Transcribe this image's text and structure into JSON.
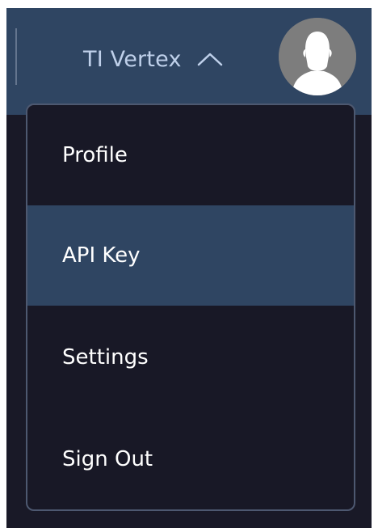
{
  "header": {
    "account_name": "TI Vertex",
    "toggle_icon": "chevron-up-icon",
    "avatar_icon": "user-avatar-icon"
  },
  "menu": {
    "items": [
      {
        "label": "Profile",
        "active": false
      },
      {
        "label": "API Key",
        "active": true
      },
      {
        "label": "Settings",
        "active": false
      },
      {
        "label": "Sign Out",
        "active": false
      }
    ]
  },
  "colors": {
    "header_bg": "#2f4562",
    "page_bg": "#191927",
    "menu_bg": "#181826",
    "menu_border": "#4d5870",
    "active_bg": "#2f4562",
    "account_text": "#bfd0ea",
    "menu_text": "#ffffff",
    "avatar_bg": "#7d7d7d"
  }
}
